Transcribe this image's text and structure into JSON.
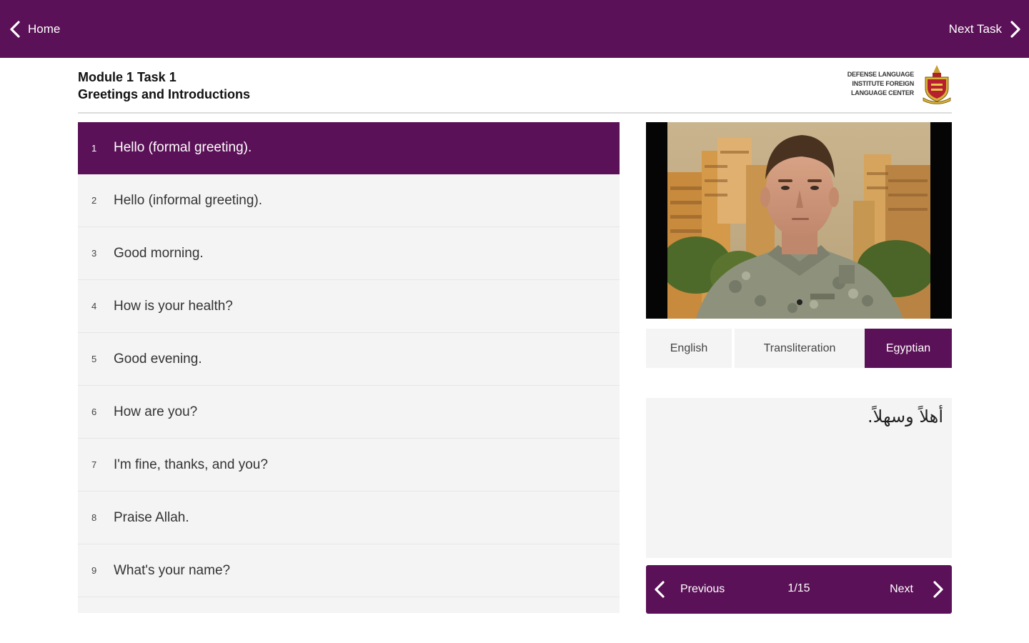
{
  "topbar": {
    "home_label": "Home",
    "next_task_label": "Next Task",
    "back_icon": "chevron-left-icon",
    "forward_icon": "chevron-right-icon"
  },
  "header": {
    "module": "Module 1 Task 1",
    "title": "Greetings and Introductions",
    "logo_text": "DEFENSE LANGUAGE\nINSTITUTE FOREIGN\nLANGUAGE CENTER"
  },
  "phrases": [
    {
      "num": "1",
      "text": "Hello (formal greeting)."
    },
    {
      "num": "2",
      "text": "Hello (informal greeting)."
    },
    {
      "num": "3",
      "text": "Good morning."
    },
    {
      "num": "4",
      "text": "How is your health?"
    },
    {
      "num": "5",
      "text": "Good evening."
    },
    {
      "num": "6",
      "text": "How are you?"
    },
    {
      "num": "7",
      "text": "I'm fine, thanks, and you?"
    },
    {
      "num": "8",
      "text": "Praise Allah."
    },
    {
      "num": "9",
      "text": "What's your name?"
    }
  ],
  "tabs": {
    "english": "English",
    "transliteration": "Transliteration",
    "egyptian": "Egyptian",
    "selected": "Egyptian"
  },
  "display": {
    "text": "أهلاً وسهلاً."
  },
  "pager": {
    "previous_label": "Previous",
    "next_label": "Next",
    "count": "1/15"
  },
  "colors": {
    "accent": "#5b1157",
    "panel": "#f4f4f4",
    "text": "#333333"
  }
}
